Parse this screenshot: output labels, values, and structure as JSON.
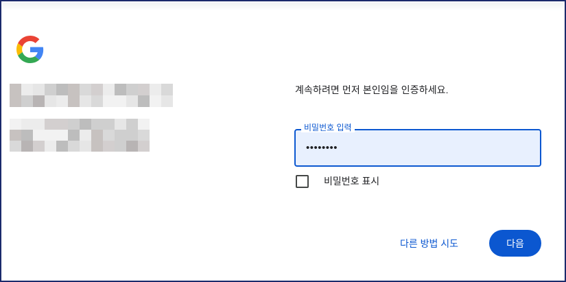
{
  "logo": {
    "icon": "google-g-icon"
  },
  "account": {
    "name_redacted": true,
    "email_redacted": true
  },
  "prompt": {
    "text": "계속하려면 먼저 본인임을 인증하세요."
  },
  "password_field": {
    "label": "비밀번호 입력",
    "value": "••••••••",
    "border_color": "#0b57d0",
    "fill_color": "#e8f0fe"
  },
  "show_password": {
    "label": "비밀번호 표시",
    "checked": false
  },
  "actions": {
    "try_another_label": "다른 방법 시도",
    "next_label": "다음",
    "accent": "#0b57d0"
  }
}
